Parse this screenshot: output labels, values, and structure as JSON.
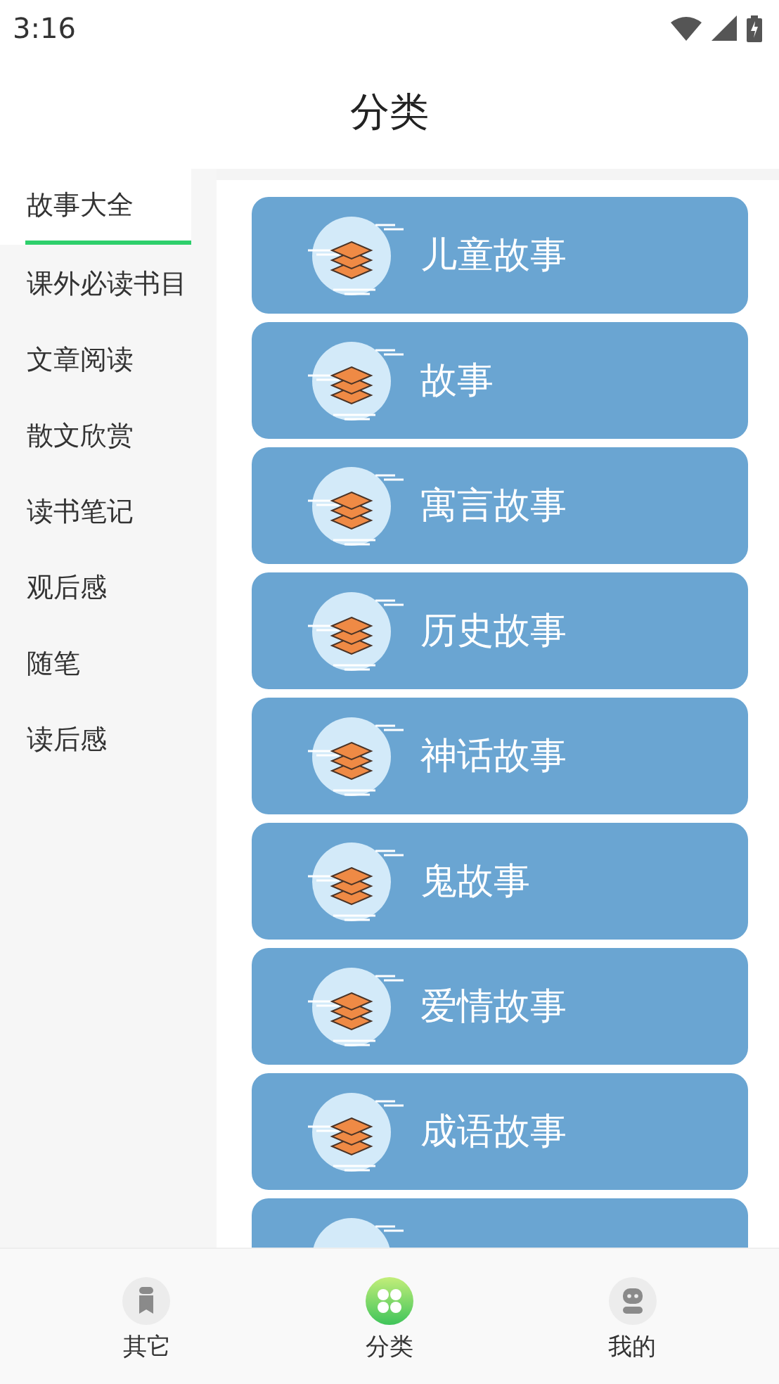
{
  "status_bar": {
    "time": "3:16"
  },
  "header": {
    "title": "分类"
  },
  "sidebar": {
    "items": [
      {
        "label": "故事大全",
        "selected": true
      },
      {
        "label": "课外必读书目",
        "selected": false
      },
      {
        "label": "文章阅读",
        "selected": false
      },
      {
        "label": "散文欣赏",
        "selected": false
      },
      {
        "label": "读书笔记",
        "selected": false
      },
      {
        "label": "观后感",
        "selected": false
      },
      {
        "label": "随笔",
        "selected": false
      },
      {
        "label": "读后感",
        "selected": false
      }
    ]
  },
  "categories": [
    {
      "kind": "card",
      "title": "儿童故事"
    },
    {
      "kind": "card",
      "title": "故事"
    },
    {
      "kind": "card",
      "title": "寓言故事"
    },
    {
      "kind": "card",
      "title": "历史故事"
    },
    {
      "kind": "card",
      "title": "神话故事"
    },
    {
      "kind": "card",
      "title": "鬼故事"
    },
    {
      "kind": "card",
      "title": "爱情故事"
    },
    {
      "kind": "card",
      "title": "成语故事"
    },
    {
      "kind": "cut"
    }
  ],
  "bottom_nav": [
    {
      "kind": "bookmark",
      "label": "其它",
      "selected": false
    },
    {
      "kind": "grid",
      "label": "分类",
      "selected": true
    },
    {
      "kind": "robot",
      "label": "我的",
      "selected": false
    }
  ]
}
